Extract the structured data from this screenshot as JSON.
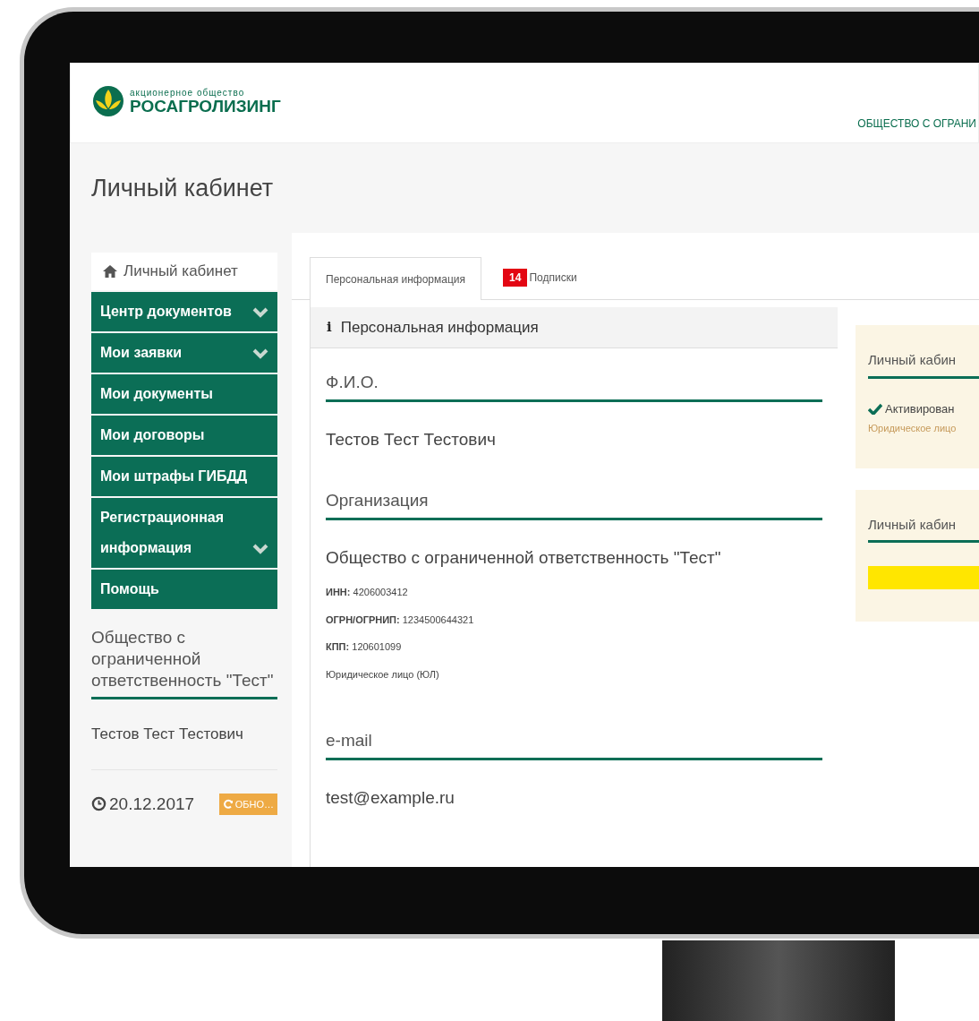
{
  "logo": {
    "small": "акционерное общество",
    "name": "РОСАГРОЛИЗИНГ"
  },
  "header_org": "ОБЩЕСТВО С ОГРАНИ",
  "page_title": "Личный кабинет",
  "sidebar": {
    "home": "Личный кабинет",
    "items": [
      {
        "label": "Центр документов",
        "expandable": true
      },
      {
        "label": "Мои заявки",
        "expandable": true
      },
      {
        "label": "Мои документы",
        "expandable": false
      },
      {
        "label": "Мои договоры",
        "expandable": false
      },
      {
        "label": "Мои штрафы ГИБДД",
        "expandable": false
      },
      {
        "label": "Регистрационная информация",
        "expandable": true
      },
      {
        "label": "Помощь",
        "expandable": false
      }
    ],
    "org": "Общество с ограниченной ответственность \"Тест\"",
    "user": "Тестов Тест Тестович",
    "date": "20.12.2017",
    "refresh": "ОБНО…"
  },
  "tabs": [
    {
      "label": "Персональная информация",
      "selected": true
    },
    {
      "label": "Подписки",
      "badge": "14",
      "selected": false
    }
  ],
  "panel": {
    "icon": "i",
    "title": "Персональная информация",
    "sections": [
      {
        "label": "Ф.И.О.",
        "value": "Тестов Тест Тестович"
      },
      {
        "label": "Организация",
        "value": "Общество с ограниченной ответственность \"Тест\"",
        "details": [
          {
            "label": "ИНН:",
            "value": "4206003412"
          },
          {
            "label": "ОГРН/ОГРНИП:",
            "value": "1234500644321"
          },
          {
            "label": "КПП:",
            "value": "120601099"
          },
          {
            "value": "Юридическое лицо (ЮЛ)"
          }
        ]
      },
      {
        "label": "e-mail",
        "value": "test@example.ru"
      }
    ]
  },
  "side_cards": [
    {
      "kind": "status",
      "title": "Личный кабин",
      "status": "Активирован",
      "note": "Юридическое лицо"
    },
    {
      "kind": "bar",
      "title": "Личный кабин"
    }
  ]
}
